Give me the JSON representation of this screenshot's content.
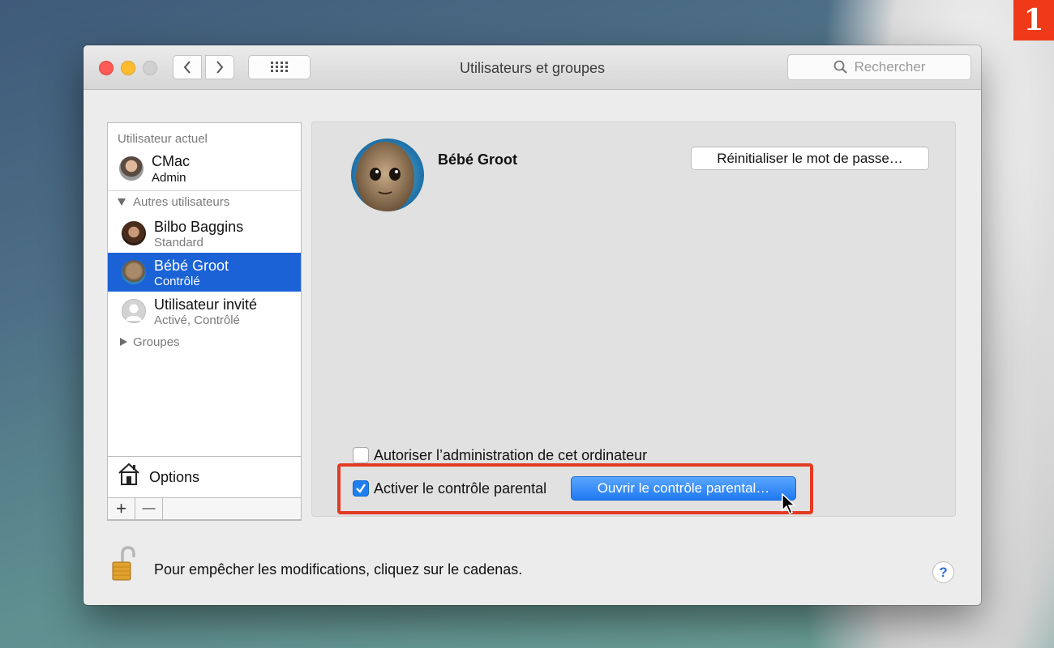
{
  "badge": "1",
  "window": {
    "title": "Utilisateurs et groupes",
    "search_placeholder": "Rechercher"
  },
  "sidebar": {
    "current_header": "Utilisateur actuel",
    "current_user": {
      "name": "CMac",
      "role": "Admin"
    },
    "others_header": "Autres utilisateurs",
    "others": [
      {
        "name": "Bilbo Baggins",
        "role": "Standard"
      },
      {
        "name": "Bébé Groot",
        "role": "Contrôlé",
        "selected": true
      },
      {
        "name": "Utilisateur invité",
        "role": "Activé, Contrôlé"
      }
    ],
    "groups_label": "Groupes",
    "options_label": "Options",
    "add_label": "+",
    "remove_label": "—"
  },
  "main": {
    "user_name": "Bébé Groot",
    "reset_password_label": "Réinitialiser le mot de passe…",
    "admin_checkbox_label": "Autoriser l’administration de cet ordinateur",
    "admin_checked": false,
    "parental_checkbox_label": "Activer le contrôle parental",
    "parental_checked": true,
    "open_parental_label": "Ouvrir le contrôle parental…"
  },
  "footer": {
    "lock_text": "Pour empêcher les modifications, cliquez sur le cadenas.",
    "help_label": "?"
  },
  "colors": {
    "selection": "#1a62d6",
    "highlight_box": "#e33a23",
    "primary_button": "#1f79f0"
  }
}
